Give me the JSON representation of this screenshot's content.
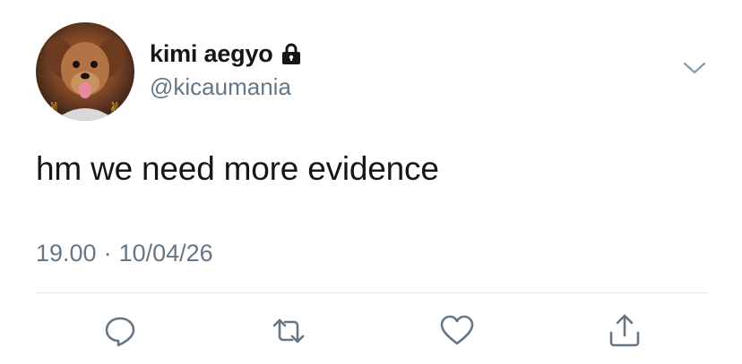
{
  "user": {
    "display_name": "kimi aegyo",
    "handle": "@kicaumania",
    "protected_icon": "lock-icon",
    "avatar": "dog-photo-avatar"
  },
  "tweet": {
    "text": "hm we need more evidence",
    "time": "19.00",
    "separator": "·",
    "date": "10/04/26"
  },
  "menu": {
    "icon": "chevron-down-icon"
  },
  "actions": [
    {
      "name": "reply",
      "icon": "speech-bubble-icon"
    },
    {
      "name": "retweet",
      "icon": "retweet-arrows-icon"
    },
    {
      "name": "like",
      "icon": "heart-icon"
    },
    {
      "name": "share",
      "icon": "share-upload-icon"
    }
  ],
  "colors": {
    "primary_text": "#14171a",
    "secondary_text": "#657786",
    "divider": "#e1e8ed",
    "icon": "#657786"
  }
}
